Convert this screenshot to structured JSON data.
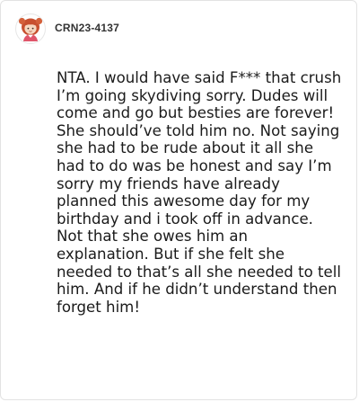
{
  "comment": {
    "username": "CRN23-4137",
    "avatar_icon": "cartoon-redhead-avatar-icon",
    "body": "NTA. I would have said F*** that crush I’m going skydiving sorry. Dudes will come and go but besties are forever! She should’ve told him no. Not saying she had to be rude about it all she had to do was be honest and say I’m sorry my friends have already planned this awesome day for my birthday and i took off in advance. Not that she owes him an explanation. But if she felt she needed to that’s all she needed to tell him. And if he didn’t understand then forget him!"
  }
}
